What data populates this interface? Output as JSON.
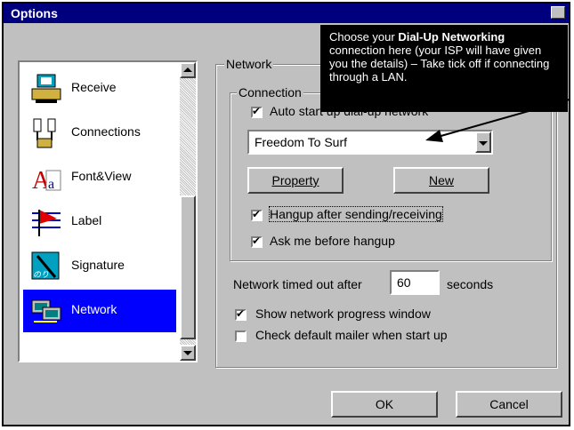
{
  "window": {
    "title": "Options"
  },
  "sidebar": {
    "items": [
      {
        "label": "Receive",
        "icon": "receive-icon"
      },
      {
        "label": "Connections",
        "icon": "connections-icon"
      },
      {
        "label": "Font&View",
        "icon": "font-view-icon"
      },
      {
        "label": "Label",
        "icon": "label-flag-icon"
      },
      {
        "label": "Signature",
        "icon": "signature-icon"
      },
      {
        "label": "Network",
        "icon": "network-icon",
        "selected": true
      }
    ]
  },
  "network": {
    "group_label": "Network",
    "connection_label": "Connection",
    "auto_start_label": "Auto start up dial-up network",
    "auto_start_checked": true,
    "dialup_selected": "Freedom To Surf",
    "property_button": "Property",
    "new_button": "New",
    "hangup_label": "Hangup after sending/receiving",
    "hangup_checked": true,
    "ask_label": "Ask me before hangup",
    "ask_checked": true,
    "timeout_prefix": "Network timed out after",
    "timeout_value": "60",
    "timeout_suffix": "seconds",
    "show_progress_label": "Show network progress window",
    "show_progress_checked": true,
    "check_mailer_label": "Check default mailer when start up",
    "check_mailer_checked": false
  },
  "buttons": {
    "ok": "OK",
    "cancel": "Cancel"
  },
  "annotation": {
    "line1_prefix": "Choose your ",
    "line1_bold": "Dial-Up Networking",
    "rest": "connection here (your ISP will have given you the details) – Take tick off if connecting through a LAN."
  },
  "colors": {
    "titlebar": "#00007f",
    "selection": "#0000ff",
    "face": "#c0c0c0"
  }
}
